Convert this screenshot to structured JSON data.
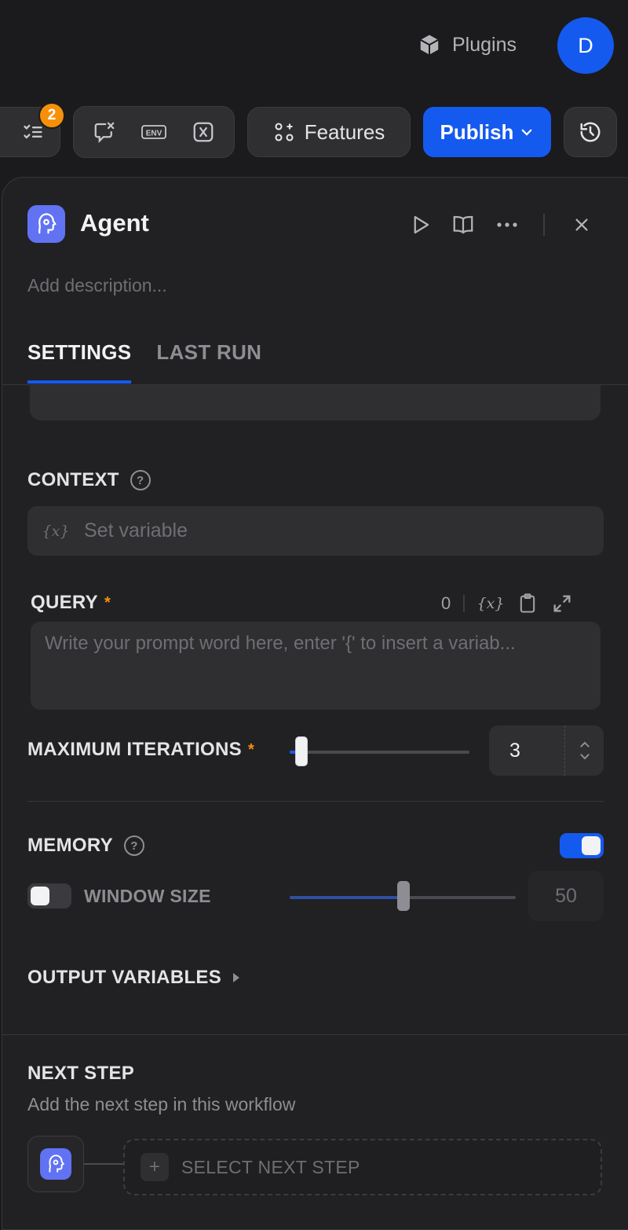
{
  "header": {
    "plugins_label": "Plugins",
    "avatar_initial": "D"
  },
  "toolbar": {
    "checklist_badge": "2",
    "env_label": "ENV",
    "features_label": "Features",
    "publish_label": "Publish"
  },
  "node": {
    "title": "Agent",
    "description_placeholder": "Add description...",
    "tabs": [
      {
        "label": "SETTINGS",
        "active": true
      },
      {
        "label": "LAST RUN",
        "active": false
      }
    ]
  },
  "context": {
    "label": "CONTEXT",
    "input_placeholder": "Set variable"
  },
  "query": {
    "label": "QUERY",
    "required_mark": "*",
    "char_count": "0",
    "placeholder": "Write your prompt word here, enter '{' to insert a variab..."
  },
  "max_iterations": {
    "label": "MAXIMUM ITERATIONS",
    "required_mark": "*",
    "value": "3",
    "slider_fraction": 0.06
  },
  "memory": {
    "label": "MEMORY",
    "enabled": true,
    "window_size_label": "WINDOW SIZE",
    "window_size_enabled": false,
    "window_size_value": "50",
    "window_slider_fraction": 0.5
  },
  "output_variables": {
    "label": "OUTPUT VARIABLES"
  },
  "next_step": {
    "title": "NEXT STEP",
    "description": "Add the next step in this workflow",
    "select_label": "SELECT NEXT STEP"
  },
  "colors": {
    "accent": "#155aef",
    "badge": "#f79009",
    "node_icon": "#6172f3",
    "background": "#1b1b1d"
  }
}
